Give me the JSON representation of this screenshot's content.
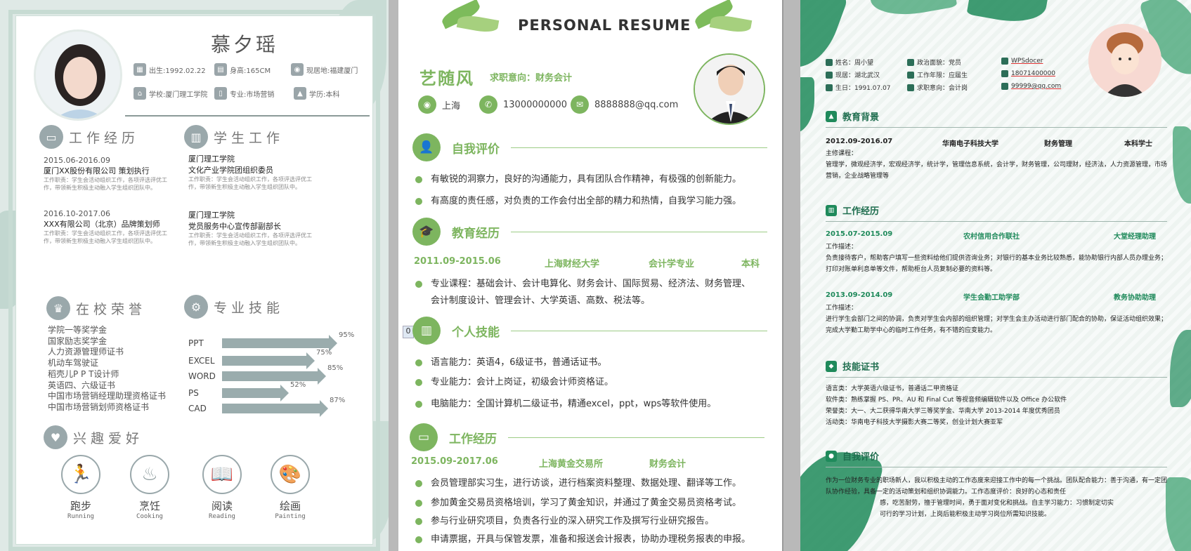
{
  "resume1": {
    "name": "慕夕瑶",
    "info": [
      {
        "icon": "calendar-icon",
        "text": "出生:1992.02.22"
      },
      {
        "icon": "ruler-icon",
        "text": "身高:165CM"
      },
      {
        "icon": "location-icon",
        "text": "现居地:福建厦门"
      },
      {
        "icon": "school-icon",
        "text": "学校:厦门理工学院"
      },
      {
        "icon": "book-icon",
        "text": "专业:市场营销"
      },
      {
        "icon": "graduation-cap-icon",
        "text": "学历:本科"
      }
    ],
    "sections": {
      "work": "工作经历",
      "student": "学生工作",
      "honors": "在校荣誉",
      "skills": "专业技能",
      "hobbies": "兴趣爱好"
    },
    "work": [
      {
        "date": "2015.06-2016.09",
        "title": "厦门XX股份有限公司 策划执行",
        "desc": "工作职责：学生会活动组织工作，各项评选评优工作，带领新生积极主动融入学生组织团队中。"
      },
      {
        "date": "2016.10-2017.06",
        "title": "XXX有限公司（北京）品牌策划师",
        "desc": "工作职责：学生会活动组织工作，各项评选评优工作，带领新生积极主动融入学生组织团队中。"
      }
    ],
    "student": [
      {
        "org": "厦门理工学院",
        "title": "文化产业学院团组织委员",
        "desc": "工作职责：学生会活动组织工作，各项评选评优工作，带领新生积极主动融入学生组织团队中。"
      },
      {
        "org": "厦门理工学院",
        "title": "党员服务中心宣传部副部长",
        "desc": "工作职责：学生会活动组织工作，各项评选评优工作，带领新生积极主动融入学生组织团队中。"
      }
    ],
    "honors": [
      "学院一等奖学金",
      "国家励志奖学金",
      "人力资源管理师证书",
      "机动车驾驶证",
      "稻壳儿P P T设计师",
      "英语四、六级证书",
      "中国市场营销经理助理资格证书",
      "中国市场营销划师资格证书"
    ],
    "skills": [
      {
        "name": "PPT",
        "percent": 95,
        "label": "95%"
      },
      {
        "name": "EXCEL",
        "percent": 75,
        "label": "75%"
      },
      {
        "name": "WORD",
        "percent": 85,
        "label": "85%"
      },
      {
        "name": "PS",
        "percent": 52,
        "label": "52%"
      },
      {
        "name": "CAD",
        "percent": 87,
        "label": "87%"
      }
    ],
    "hobbies": [
      {
        "icon": "running-icon",
        "glyph": "🏃",
        "label": "跑步",
        "en": "Running"
      },
      {
        "icon": "cooking-icon",
        "glyph": "♨",
        "label": "烹饪",
        "en": "Cooking"
      },
      {
        "icon": "book-open-icon",
        "glyph": "📖",
        "label": "阅读",
        "en": "Reading"
      },
      {
        "icon": "palette-icon",
        "glyph": "🎨",
        "label": "绘画",
        "en": "Painting"
      }
    ]
  },
  "resume2": {
    "title": "PERSONAL RESUME",
    "name": "艺随风",
    "objective": "求职意向：财务会计",
    "contact": [
      {
        "icon": "location-pin-icon",
        "text": "上海"
      },
      {
        "icon": "phone-icon",
        "text": "13000000000"
      },
      {
        "icon": "mail-icon",
        "text": "8888888@qq.com"
      }
    ],
    "sections": {
      "self": "自我评价",
      "edu": "教育经历",
      "skills": "个人技能",
      "work": "工作经历"
    },
    "self_eval": [
      "有敏锐的洞察力，良好的沟通能力，具有团队合作精神，有极强的创新能力。",
      "有高度的责任感，对负责的工作会付出全部的精力和热情，自我学习能力强。"
    ],
    "edu": {
      "date": "2011.09-2015.06",
      "school": "上海财经大学",
      "major": "会计学专业",
      "degree": "本科"
    },
    "edu_desc": "专业课程：基础会计、会计电算化、财务会计、国际贸易、经济法、财务管理、会计制度设计、管理会计、大学英语、高数、税法等。",
    "skills": [
      "语言能力：英语4，6级证书，普通话证书。",
      "专业能力：会计上岗证，初级会计师资格证。",
      "电脑能力：全国计算机二级证书，精通excel，ppt，wps等软件使用。"
    ],
    "badge": "0",
    "work": {
      "date": "2015.09-2017.06",
      "company": "上海黄金交易所",
      "role": "财务会计"
    },
    "work_items": [
      "会员管理部实习生，进行访谈，进行档案资料整理、数据处理、翻译等工作。",
      "参加黄金交易员资格培训，学习了黄金知识，并通过了黄金交易员资格考试。",
      "参与行业研究项目，负责各行业的深入研究工作及撰写行业研究报告。",
      "申请票据，开具与保管发票，准备和报送会计报表，协助办理税务报表的申报。"
    ]
  },
  "resume3": {
    "info": [
      {
        "icon": "user-icon",
        "text": "姓名：周小望"
      },
      {
        "icon": "flag-icon",
        "text": "政治面貌：党员"
      },
      {
        "icon": "web-icon",
        "text": "WPSdocer",
        "underline": true
      },
      {
        "icon": "home-icon",
        "text": "现居：湖北武汉"
      },
      {
        "icon": "briefcase-icon",
        "text": "工作年限：应届生"
      },
      {
        "icon": "phone-icon",
        "text": "18071400000",
        "underline": true
      },
      {
        "icon": "cake-icon",
        "text": "生日：1991.07.07"
      },
      {
        "icon": "target-icon",
        "text": "求职意向：会计岗"
      },
      {
        "icon": "mail-icon",
        "text": "99999@qq.com",
        "underline": true
      }
    ],
    "sections": {
      "edu": "教育背景",
      "work": "工作经历",
      "certs": "技能证书",
      "self": "自我评价"
    },
    "edu": {
      "date": "2012.09-2016.07",
      "school": "华南电子科技大学",
      "major": "财务管理",
      "degree": "本科学士"
    },
    "courses_label": "主修课程：",
    "courses": "管理学，微观经济学，宏观经济学，统计学，管理信息系统，会计学，财务管理，公司理财，经济法，人力资源管理，市场营销，企业战略管理等",
    "jobs": [
      {
        "date": "2015.07-2015.09",
        "org": "农村信用合作联社",
        "role": "大堂经理助理",
        "label": "工作描述：",
        "desc": "负责接待客户，帮助客户填写一些资料给他们提供咨询业务；对银行的基本业务比较熟悉，能协助银行内部人员办理业务；打印对账单利息单等文件，帮助柜台人员复制必要的资料等。"
      },
      {
        "date": "2013.09-2014.09",
        "org": "学生会勤工助学部",
        "role": "教务协助助理",
        "label": "工作描述：",
        "desc": "进行学生会部门之间的协调，负责对学生会内部的组织管理；对学生会主办活动进行部门配合的协助，保证活动组织效果；完成大学勤工助学中心的临时工作任务，有不错的应变能力。"
      }
    ],
    "certs": [
      "语言类：大学英语六级证书，普通话二甲资格证",
      "软件类：熟练掌握 PS、PR、AU 和 Final Cut 等视音频编辑软件以及 Office 办公软件",
      "荣誉类：大一、大二获得华南大学三等奖学金、华南大学 2013-2014 年度优秀团员",
      "活动类：华南电子科技大学摄影大赛二等奖，创业计划大赛亚军"
    ],
    "self_eval_1": "作为一位财务专业的职场新人，我以积极主动的工作态度来迎接工作中的每一个挑战。团队配合能力：善于沟通，有一定团队协作经验，具备一定的活动策划和组织协调能力。工作态度评价：良好的心态和责任",
    "self_eval_2": "感，吃苦耐劳，擅于管理时间，勇于面对变化和挑战。自主学习能力：习惯制定切实",
    "self_eval_3": "可行的学习计划，上岗后能积极主动学习岗位所需知识技能。"
  }
}
